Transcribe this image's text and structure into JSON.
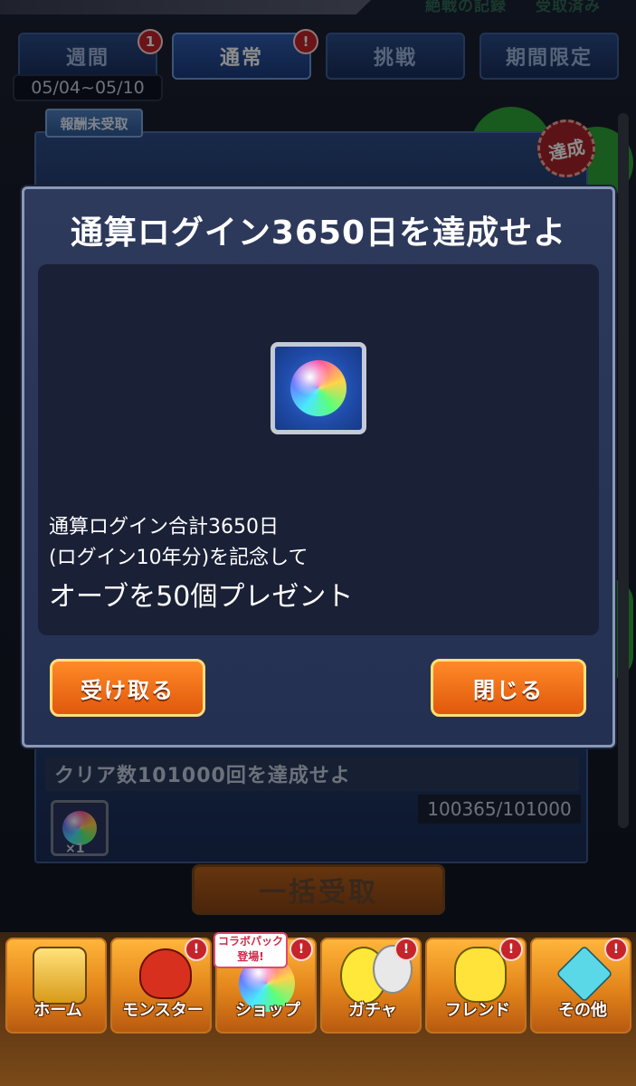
{
  "header": {
    "record_label": "絶戦の記録",
    "received_label": "受取済み"
  },
  "tabs": [
    {
      "label": "週間",
      "badge": "1"
    },
    {
      "label": "通常",
      "badge": "!"
    },
    {
      "label": "挑戦"
    },
    {
      "label": "期間限定"
    }
  ],
  "date_range": "05/04~05/10",
  "mission_list": {
    "unclaimed_tag": "報酬未受取",
    "achieved_stamp": "達成",
    "card2": {
      "title": "クリア数101000回を達成せよ",
      "progress": "100365/101000",
      "reward_count": "×1"
    },
    "bulk_claim_label": "一括受取"
  },
  "dialog": {
    "title": "通算ログイン3650日を達成せよ",
    "reward_icon": "rainbow-orb-icon",
    "description_line1": "通算ログイン合計3650日",
    "description_line2": "(ログイン10年分)を記念して",
    "description_line3": "オーブを50個プレゼント",
    "receive_button": "受け取る",
    "close_button": "閉じる"
  },
  "bottom_nav": [
    {
      "label": "ホーム"
    },
    {
      "label": "モンスター",
      "alert": "!"
    },
    {
      "label": "ショップ",
      "alert": "!",
      "promo": "コラボパック\n登場!"
    },
    {
      "label": "ガチャ",
      "alert": "!"
    },
    {
      "label": "フレンド",
      "alert": "!"
    },
    {
      "label": "その他",
      "alert": "!"
    }
  ],
  "colors": {
    "accent_orange": "#ff8a28",
    "dialog_bg": "#2e3a5c",
    "alert_red": "#c4242a"
  }
}
